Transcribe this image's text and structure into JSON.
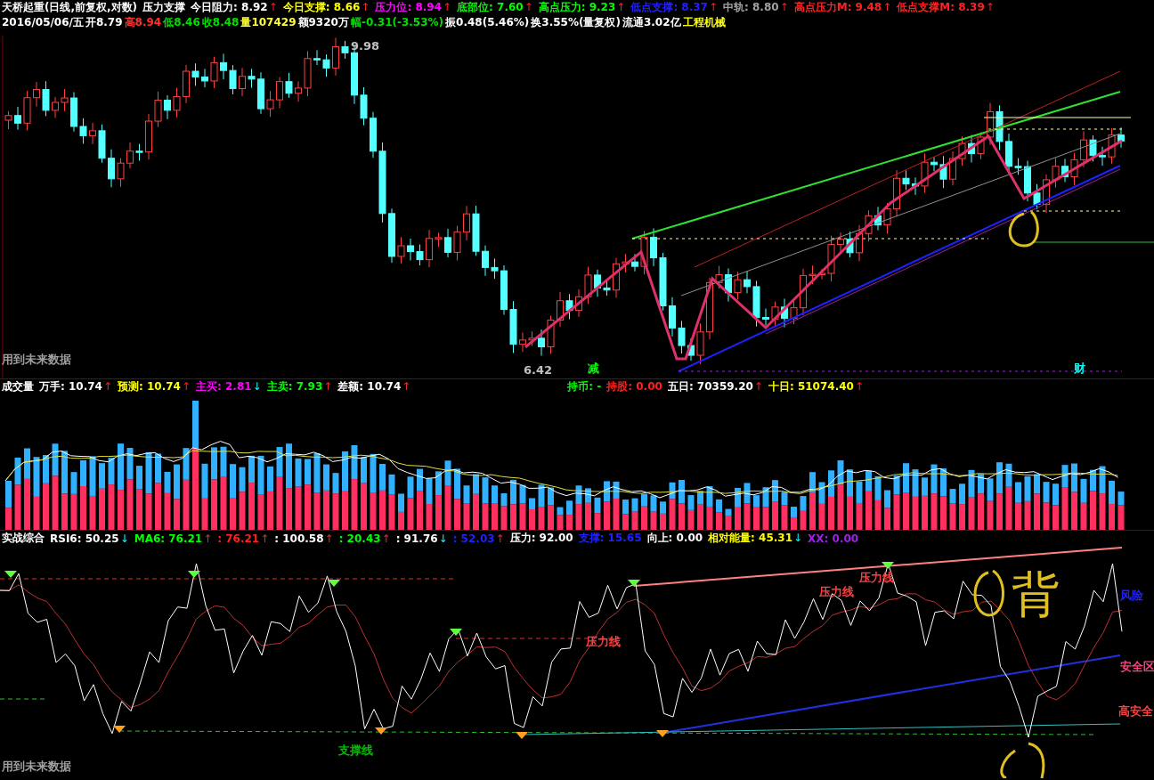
{
  "price_panel": {
    "title": "天桥起重(日线,前复权,对数)",
    "indicator": "压力支撑",
    "values": [
      {
        "label": "今日阻力:",
        "value": "8.92",
        "arrow": "↑",
        "color": "#ffffff"
      },
      {
        "label": "今日支撑:",
        "value": "8.66",
        "arrow": "↑",
        "color": "#ffff00"
      },
      {
        "label": "压力位:",
        "value": "8.94",
        "arrow": "↑",
        "color": "#ff00ff"
      },
      {
        "label": "底部位:",
        "value": "7.60",
        "arrow": "↑",
        "color": "#00ff00"
      },
      {
        "label": "高点压力:",
        "value": "9.23",
        "arrow": "↑",
        "color": "#00ff00"
      },
      {
        "label": "低点支撑:",
        "value": "8.37",
        "arrow": "↑",
        "color": "#2020ff"
      },
      {
        "label": "中轨:",
        "value": "8.80",
        "arrow": "↑",
        "color": "#a0a0a0"
      },
      {
        "label": "高点压力M:",
        "value": "9.48",
        "arrow": "↑",
        "color": "#ff2020"
      },
      {
        "label": "低点支撑M:",
        "value": "8.39",
        "arrow": "↑",
        "color": "#ff2020"
      }
    ],
    "quote": [
      {
        "text": "2016/05/06/五",
        "color": "#ffffff"
      },
      {
        "text": "开8.79",
        "color": "#ffffff"
      },
      {
        "text": "高8.94",
        "color": "#ff3030"
      },
      {
        "text": "低8.46",
        "color": "#00e000"
      },
      {
        "text": "收8.48",
        "color": "#00e000"
      },
      {
        "text": "量107429",
        "color": "#ffff40"
      },
      {
        "text": "额9320万",
        "color": "#ffffff"
      },
      {
        "text": "幅-0.31(-3.53%)",
        "color": "#00e000"
      },
      {
        "text": "振0.48(5.46%)",
        "color": "#ffffff"
      },
      {
        "text": "换3.55%(量复权)",
        "color": "#ffffff"
      },
      {
        "text": "流通3.02亿",
        "color": "#ffffff"
      },
      {
        "text": "工程机械",
        "color": "#ffff00"
      }
    ],
    "chart_labels": [
      {
        "text": "9.98",
        "color": "#c0c0c0"
      },
      {
        "text": "6.42",
        "color": "#c0c0c0"
      },
      {
        "text": "减",
        "color": "#00ff00"
      },
      {
        "text": "财",
        "color": "#00ffff"
      },
      {
        "text": "用到未来数据",
        "color": "#a0a0a0"
      }
    ]
  },
  "volume_panel": {
    "title": "成交量",
    "values": [
      {
        "label": "万手:",
        "value": "10.74",
        "arrow": "↑",
        "color": "#ffffff"
      },
      {
        "label": "预测:",
        "value": "10.74",
        "arrow": "↑",
        "color": "#ffff00"
      },
      {
        "label": "主买:",
        "value": "2.81",
        "arrow": "↓",
        "color": "#ff00ff"
      },
      {
        "label": "主卖:",
        "value": "7.93",
        "arrow": "↑",
        "color": "#00ff00"
      },
      {
        "label": "差额:",
        "value": "10.74",
        "arrow": "↑",
        "color": "#ffffff"
      },
      {
        "label": "持币:",
        "value": "-",
        "color": "#00ff00"
      },
      {
        "label": "持股:",
        "value": "0.00",
        "color": "#ff2020"
      },
      {
        "label": "五日:",
        "value": "70359.20",
        "arrow": "↑",
        "color": "#ffffff"
      },
      {
        "label": "十日:",
        "value": "51074.40",
        "arrow": "↑",
        "color": "#ffff00"
      }
    ]
  },
  "rsi_panel": {
    "title": "实战综合",
    "values": [
      {
        "label": "RSI6:",
        "value": "50.25",
        "arrow": "↓",
        "color": "#ffffff"
      },
      {
        "label": "MA6:",
        "value": "76.21",
        "arrow": "↑",
        "color": "#00ff00"
      },
      {
        "label": ":",
        "value": "76.21",
        "arrow": "↑",
        "color": "#ff2020"
      },
      {
        "label": ":",
        "value": "100.58",
        "arrow": "↑",
        "color": "#ffffff"
      },
      {
        "label": ":",
        "value": "20.43",
        "arrow": "↑",
        "color": "#00ff00"
      },
      {
        "label": ":",
        "value": "91.76",
        "arrow": "↓",
        "color": "#ffffff"
      },
      {
        "label": ":",
        "value": "52.03",
        "arrow": "↑",
        "color": "#2020ff"
      },
      {
        "label": "压力:",
        "value": "92.00",
        "color": "#ffffff"
      },
      {
        "label": "支撑:",
        "value": "15.65",
        "color": "#2020ff"
      },
      {
        "label": "向上:",
        "value": "0.00",
        "color": "#ffffff"
      },
      {
        "label": "相对能量:",
        "value": "45.31",
        "arrow": "↓",
        "color": "#ffff00"
      },
      {
        "label": "XX:",
        "value": "0.00",
        "color": "#a020f0"
      }
    ],
    "chart_labels": [
      {
        "text": "压力线",
        "color": "#ff4040"
      },
      {
        "text": "压力线",
        "color": "#ff4040"
      },
      {
        "text": "压力线",
        "color": "#ff4040"
      },
      {
        "text": "支撑线",
        "color": "#00c000"
      },
      {
        "text": "风险",
        "color": "#2020ff"
      },
      {
        "text": "安全区",
        "color": "#ff4080"
      },
      {
        "text": "高安全",
        "color": "#ff4040"
      },
      {
        "text": "用到未来数据",
        "color": "#a0a0a0"
      }
    ],
    "annotation": "背"
  }
}
